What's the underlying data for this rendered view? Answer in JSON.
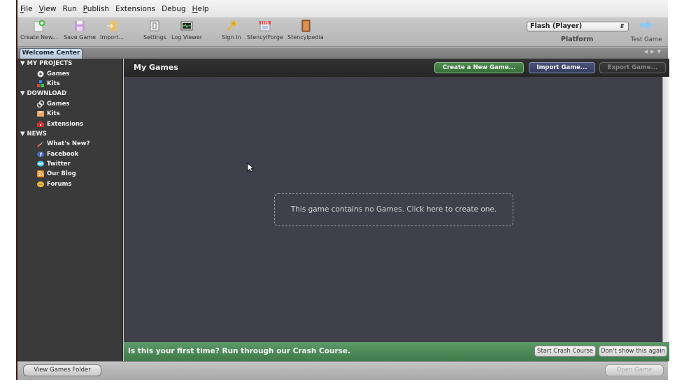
{
  "menubar": {
    "items": [
      {
        "label": "File",
        "mnemonic": "F"
      },
      {
        "label": "View",
        "mnemonic": "V"
      },
      {
        "label": "Run",
        "mnemonic": ""
      },
      {
        "label": "Publish",
        "mnemonic": "P"
      },
      {
        "label": "Extensions",
        "mnemonic": ""
      },
      {
        "label": "Debug",
        "mnemonic": ""
      },
      {
        "label": "Help",
        "mnemonic": "H"
      }
    ]
  },
  "toolbar": {
    "create_new": {
      "label": "Create New...",
      "icon": "new-document-icon"
    },
    "save_game": {
      "label": "Save Game",
      "icon": "floppy-disk-icon"
    },
    "import": {
      "label": "Import...",
      "icon": "import-icon"
    },
    "settings": {
      "label": "Settings",
      "icon": "settings-icon"
    },
    "log_viewer": {
      "label": "Log Viewer",
      "icon": "log-viewer-icon"
    },
    "sign_in": {
      "label": "Sign In",
      "icon": "key-icon"
    },
    "stencylforge": {
      "label": "StencylForge",
      "icon": "store-icon"
    },
    "stencylpedia": {
      "label": "Stencylpedia",
      "icon": "book-icon"
    },
    "platform": {
      "selected": "Flash (Player)",
      "label": "Platform"
    },
    "test_game": {
      "label": "Test Game",
      "icon": "arrow-right-icon"
    }
  },
  "tabs": {
    "welcome": "Welcome Center"
  },
  "sidebar": {
    "sections": [
      {
        "title": "MY PROJECTS",
        "items": [
          {
            "label": "Games",
            "icon": "games-disc-icon"
          },
          {
            "label": "Kits",
            "icon": "kits-blocks-icon"
          }
        ]
      },
      {
        "title": "DOWNLOAD",
        "items": [
          {
            "label": "Games",
            "icon": "download-games-icon"
          },
          {
            "label": "Kits",
            "icon": "download-kits-icon"
          },
          {
            "label": "Extensions",
            "icon": "toolbox-icon"
          }
        ]
      },
      {
        "title": "NEWS",
        "items": [
          {
            "label": "What's New?",
            "icon": "rocket-icon"
          },
          {
            "label": "Facebook",
            "icon": "facebook-icon"
          },
          {
            "label": "Twitter",
            "icon": "twitter-icon"
          },
          {
            "label": "Our Blog",
            "icon": "rss-icon"
          },
          {
            "label": "Forums",
            "icon": "forums-icon"
          }
        ]
      }
    ]
  },
  "main": {
    "title": "My Games",
    "create_button": "Create a New Game...",
    "import_button": "Import Game...",
    "export_button": "Export Game...",
    "empty_message": "This game contains no Games. Click here to create one.",
    "crash_course": {
      "text": "Is this your first time? Run through our Crash Course.",
      "start_button": "Start Crash Course",
      "dismiss_button": "Don't show this again"
    }
  },
  "bottombar": {
    "view_folder": "View Games Folder",
    "open_game": "Open Game"
  },
  "colors": {
    "create_green": "#356e35",
    "import_blue": "#343c5e",
    "crash_bar_green": "#4e8a59",
    "sidebar_bg": "#3a3a3a",
    "main_bg": "#40404a"
  }
}
